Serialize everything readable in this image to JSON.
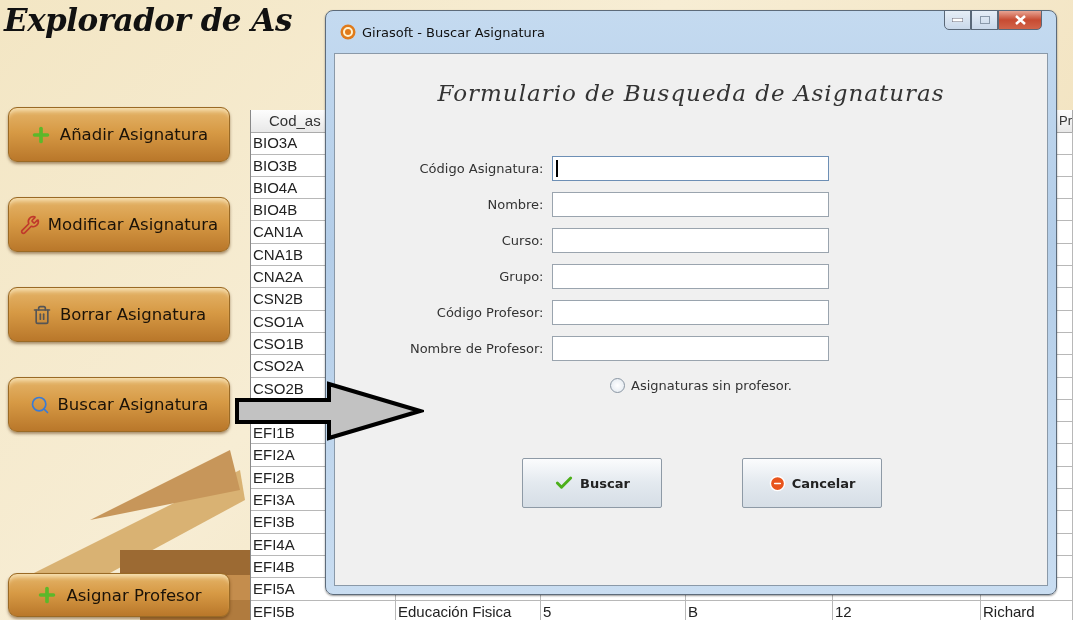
{
  "app": {
    "title": "Explorador de As",
    "sidebar_buttons": [
      {
        "label": "Añadir Asignatura",
        "kind": "add"
      },
      {
        "label": "Modificar Asignatura",
        "kind": "edit"
      },
      {
        "label": "Borrar Asignatura",
        "kind": "delete"
      },
      {
        "label": "Buscar Asignatura",
        "kind": "search"
      },
      {
        "label": "Asignar Profesor",
        "kind": "add"
      }
    ],
    "table": {
      "columns": [
        "Cod_as",
        "Pr"
      ],
      "rows": [
        {
          "code": "BIO3A",
          "under_arrow": false
        },
        {
          "code": "BIO3B",
          "under_arrow": false
        },
        {
          "code": "BIO4A",
          "under_arrow": false
        },
        {
          "code": "BIO4B",
          "under_arrow": false
        },
        {
          "code": "CAN1A",
          "under_arrow": false
        },
        {
          "code": "CNA1B",
          "under_arrow": false
        },
        {
          "code": "CNA2A",
          "under_arrow": false
        },
        {
          "code": "CSN2B",
          "under_arrow": false
        },
        {
          "code": "CSO1A",
          "under_arrow": false
        },
        {
          "code": "CSO1B",
          "under_arrow": false
        },
        {
          "code": "CSO2A",
          "under_arrow": false
        },
        {
          "code": "CSO2B",
          "under_arrow": false
        },
        {
          "under_arrow": true
        },
        {
          "code": "EFI1B",
          "under_arrow": false
        },
        {
          "code": "EFI2A",
          "under_arrow": false
        },
        {
          "code": "EFI2B",
          "under_arrow": false
        },
        {
          "code": "EFI3A",
          "under_arrow": false
        },
        {
          "code": "EFI3B",
          "under_arrow": false
        },
        {
          "code": "EFI4A",
          "under_arrow": false
        },
        {
          "code": "EFI4B",
          "under_arrow": false
        },
        {
          "code": "EFI5A",
          "under_arrow": false
        },
        {
          "code": "EFI5B",
          "under_arrow": false,
          "cells": [
            "Educación Fisica",
            "5",
            "B",
            "12",
            "Richard"
          ]
        }
      ]
    }
  },
  "dialog": {
    "title": "Girasoft - Buscar Asignatura",
    "heading": "Formulario de Busqueda de Asignaturas",
    "fields": [
      {
        "label": "Código Asignatura:",
        "focused": true
      },
      {
        "label": "Nombre:",
        "focused": false
      },
      {
        "label": "Curso:",
        "focused": false
      },
      {
        "label": "Grupo:",
        "focused": false
      },
      {
        "label": "Código Profesor:",
        "focused": false
      },
      {
        "label": "Nombre de Profesor:",
        "focused": false
      }
    ],
    "radio": {
      "label": "Asignaturas sin profesor.",
      "selected": false
    },
    "buttons": [
      {
        "label": "Buscar",
        "kind": "search"
      },
      {
        "label": "Cancelar",
        "kind": "cancel"
      }
    ]
  }
}
